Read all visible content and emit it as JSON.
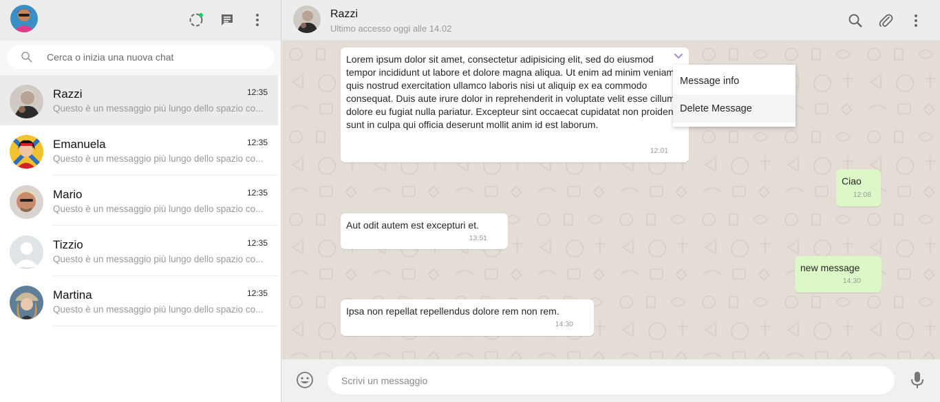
{
  "sidebar": {
    "header": {
      "icons": [
        "status-icon",
        "new-chat-icon",
        "menu-icon"
      ],
      "status_dot_color": "#09d261"
    },
    "search": {
      "placeholder": "Cerca o inizia una nuova chat"
    },
    "chats": [
      {
        "name": "Razzi",
        "time": "12:35",
        "preview": "Questo è un messaggio più lungo dello spazio co...",
        "active": true
      },
      {
        "name": "Emanuela",
        "time": "12:35",
        "preview": "Questo è un messaggio più lungo dello spazio co..."
      },
      {
        "name": "Mario",
        "time": "12:35",
        "preview": "Questo è un messaggio più lungo dello spazio co..."
      },
      {
        "name": "Tizzio",
        "time": "12:35",
        "preview": "Questo è un messaggio più lungo dello spazio co..."
      },
      {
        "name": "Martina",
        "time": "12:35",
        "preview": "Questo è un messaggio più lungo dello spazio co..."
      }
    ]
  },
  "conversation": {
    "header": {
      "name": "Razzi",
      "status": "Ultimo accesso oggi alle 14.02",
      "icons": [
        "search-icon",
        "attach-icon",
        "menu-icon"
      ]
    },
    "messages": [
      {
        "direction": "in",
        "text": "Lorem ipsum dolor sit amet, consectetur adipisicing elit, sed do eiusmod tempor incididunt ut labore et dolore magna aliqua. Ut enim ad minim veniam, quis nostrud exercitation ullamco laboris nisi ut aliquip ex ea commodo consequat. Duis aute irure dolor in reprehenderit in voluptate velit esse cillum dolore eu fugiat nulla pariatur. Excepteur sint occaecat cupidatat non proident, sunt in culpa qui officia deserunt mollit anim id est laborum.",
        "time": "12:01"
      },
      {
        "direction": "out",
        "text": "Ciao",
        "time": "12:08"
      },
      {
        "direction": "in",
        "text": "Aut odit autem est excepturi et.",
        "time": "13:51"
      },
      {
        "direction": "out",
        "text": "new message",
        "time": "14:30"
      },
      {
        "direction": "in",
        "text": "Ipsa non repellat repellendus dolore rem non rem.",
        "time": "14:30"
      }
    ],
    "context_menu": {
      "items": [
        "Message info",
        "Delete Message"
      ],
      "highlighted": "Delete Message"
    }
  },
  "composer": {
    "placeholder": "Scrivi un messaggio",
    "icons": [
      "emoji-icon",
      "microphone-icon"
    ]
  },
  "colors": {
    "header_bg": "#ededed",
    "chat_bg": "#e4ddd6",
    "outgoing_bubble": "#dcf8c6",
    "incoming_bubble": "#ffffff",
    "active_chat": "#ebebeb",
    "caret": "#a98fd6"
  }
}
